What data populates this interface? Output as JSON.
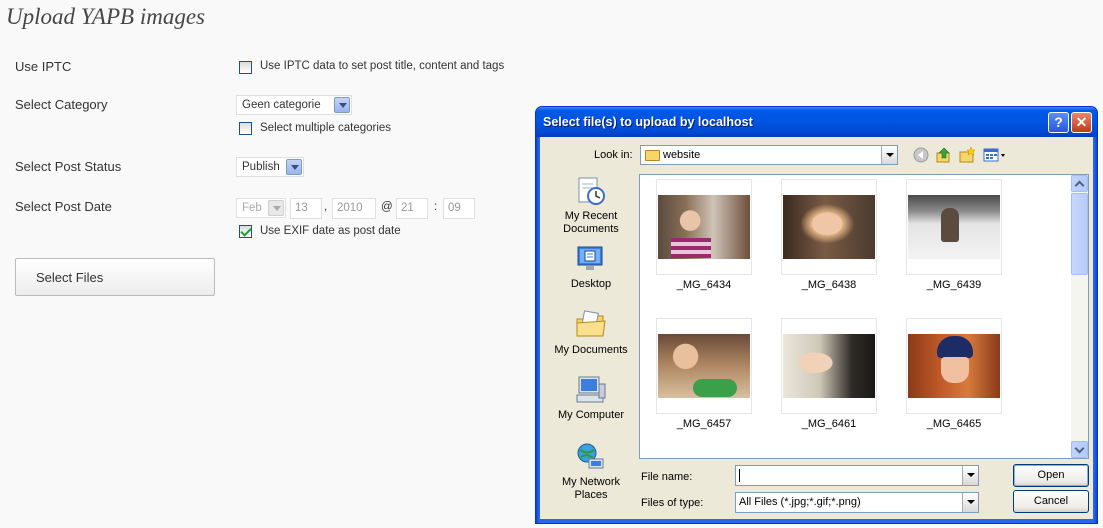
{
  "page": {
    "title": "Upload YAPB images"
  },
  "form": {
    "iptc": {
      "label": "Use IPTC",
      "checkbox_text": "Use IPTC data to set post title, content and tags",
      "checked": false
    },
    "category": {
      "label": "Select Category",
      "selected": "Geen categorie",
      "multi_text": "Select multiple categories",
      "multi_checked": false
    },
    "status": {
      "label": "Select Post Status",
      "selected": "Publish"
    },
    "date": {
      "label": "Select Post Date",
      "month": "Feb",
      "day": "13",
      "year": "2010",
      "hour": "21",
      "minute": "09",
      "sep_comma": ",",
      "sep_at": "@",
      "sep_colon": ":",
      "exif_text": "Use EXIF date as post date",
      "exif_checked": true
    },
    "select_files_label": "Select Files"
  },
  "dialog": {
    "title": "Select file(s) to upload by localhost",
    "help_glyph": "?",
    "close_glyph": "✕",
    "look_in_label": "Look in:",
    "look_in_value": "website",
    "places": [
      {
        "label": "My Recent Documents",
        "icon": "recent-documents-icon"
      },
      {
        "label": "Desktop",
        "icon": "desktop-icon"
      },
      {
        "label": "My Documents",
        "icon": "my-documents-icon"
      },
      {
        "label": "My Computer",
        "icon": "my-computer-icon"
      },
      {
        "label": "My Network Places",
        "icon": "network-places-icon"
      }
    ],
    "files": [
      {
        "name": "_MG_6434"
      },
      {
        "name": "_MG_6438"
      },
      {
        "name": "_MG_6439"
      },
      {
        "name": "_MG_6457"
      },
      {
        "name": "_MG_6461"
      },
      {
        "name": "_MG_6465"
      }
    ],
    "file_name_label": "File name:",
    "file_name_value": "",
    "file_type_label": "Files of type:",
    "file_type_value": "All Files (*.jpg;*.gif;*.png)",
    "open_label": "Open",
    "cancel_label": "Cancel"
  },
  "colors": {
    "titlebar": "#0055e3",
    "dialog_body": "#ece9d8",
    "page_bg": "#f9f9f9"
  }
}
